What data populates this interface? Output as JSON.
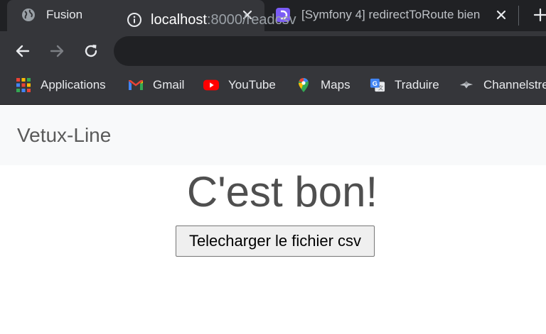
{
  "browser": {
    "tabs": [
      {
        "title": "Fusion",
        "active": true,
        "icon": "globe-icon"
      },
      {
        "title": "[Symfony 4] redirectToRoute bien",
        "active": false,
        "icon": "symfony-favicon"
      }
    ],
    "new_tab_icon": "plus-icon",
    "toolbar": {
      "url_host": "localhost",
      "url_rest": ":8000/readcsv",
      "info_icon": "info-icon"
    },
    "bookmarks": [
      {
        "label": "Applications",
        "icon": "apps-grid-icon"
      },
      {
        "label": "Gmail",
        "icon": "gmail-icon"
      },
      {
        "label": "YouTube",
        "icon": "youtube-icon"
      },
      {
        "label": "Maps",
        "icon": "maps-pin-icon"
      },
      {
        "label": "Traduire",
        "icon": "translate-icon"
      },
      {
        "label": "Channelstre",
        "icon": "channel-bird-icon"
      }
    ],
    "colors": {
      "tabstrip": "#202124",
      "toolbar": "#35363a",
      "omnibox": "#202124"
    }
  },
  "page": {
    "brand": "Vetux-Line",
    "heading": "C'est bon!",
    "download_button": "Telecharger le fichier csv",
    "colors": {
      "navbar": "#f8f9fa",
      "text": "#4f4f4f"
    }
  }
}
